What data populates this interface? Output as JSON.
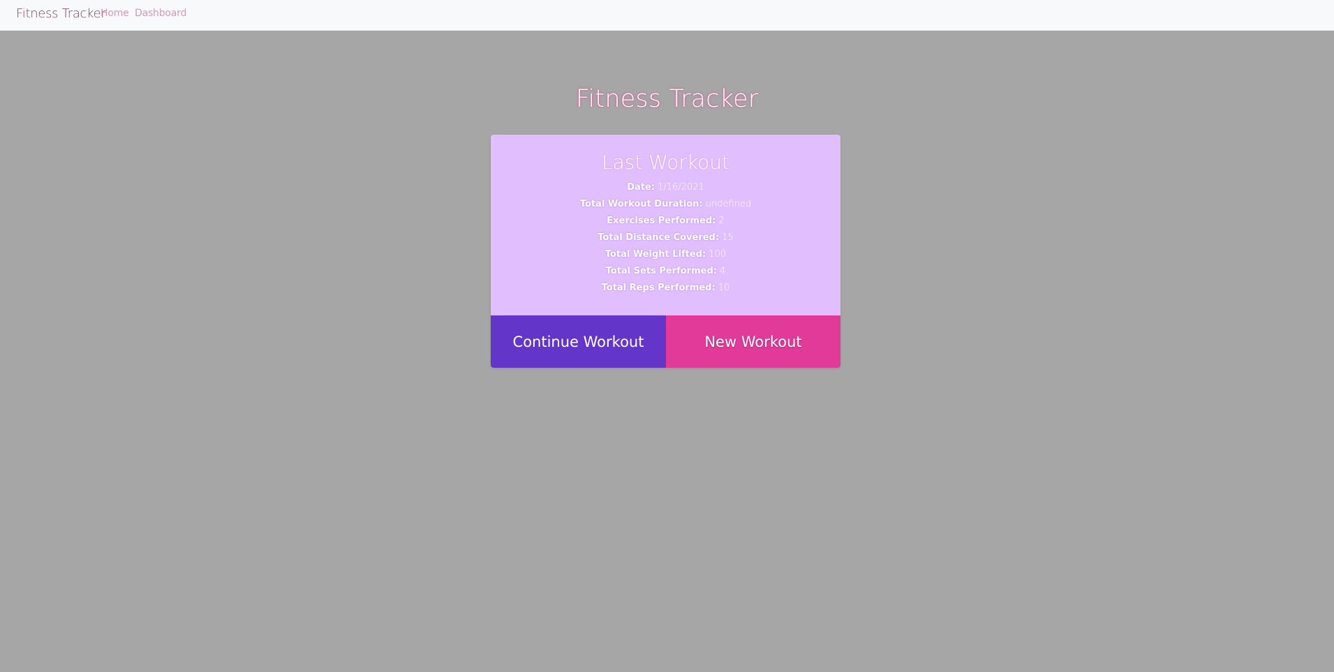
{
  "navbar": {
    "brand": "Fitness Tracker",
    "links": [
      {
        "label": "Home"
      },
      {
        "label": "Dashboard"
      }
    ]
  },
  "page": {
    "title": "Fitness Tracker"
  },
  "card": {
    "heading": "Last Workout",
    "stats": [
      {
        "label": "Date:",
        "value": "1/16/2021"
      },
      {
        "label": "Total Workout Duration:",
        "value": "undefined"
      },
      {
        "label": "Exercises Performed:",
        "value": "2"
      },
      {
        "label": "Total Distance Covered:",
        "value": "15"
      },
      {
        "label": "Total Weight Lifted:",
        "value": "100"
      },
      {
        "label": "Total Sets Performed:",
        "value": "4"
      },
      {
        "label": "Total Reps Performed:",
        "value": "10"
      }
    ],
    "buttons": {
      "continue_label": "Continue Workout",
      "new_label": "New Workout"
    }
  },
  "colors": {
    "background": "#a6a6a6",
    "navbar": "#f8f9fa",
    "card": "#e1bfff",
    "continue_button": "#6336c9",
    "new_button": "#e13a99"
  }
}
